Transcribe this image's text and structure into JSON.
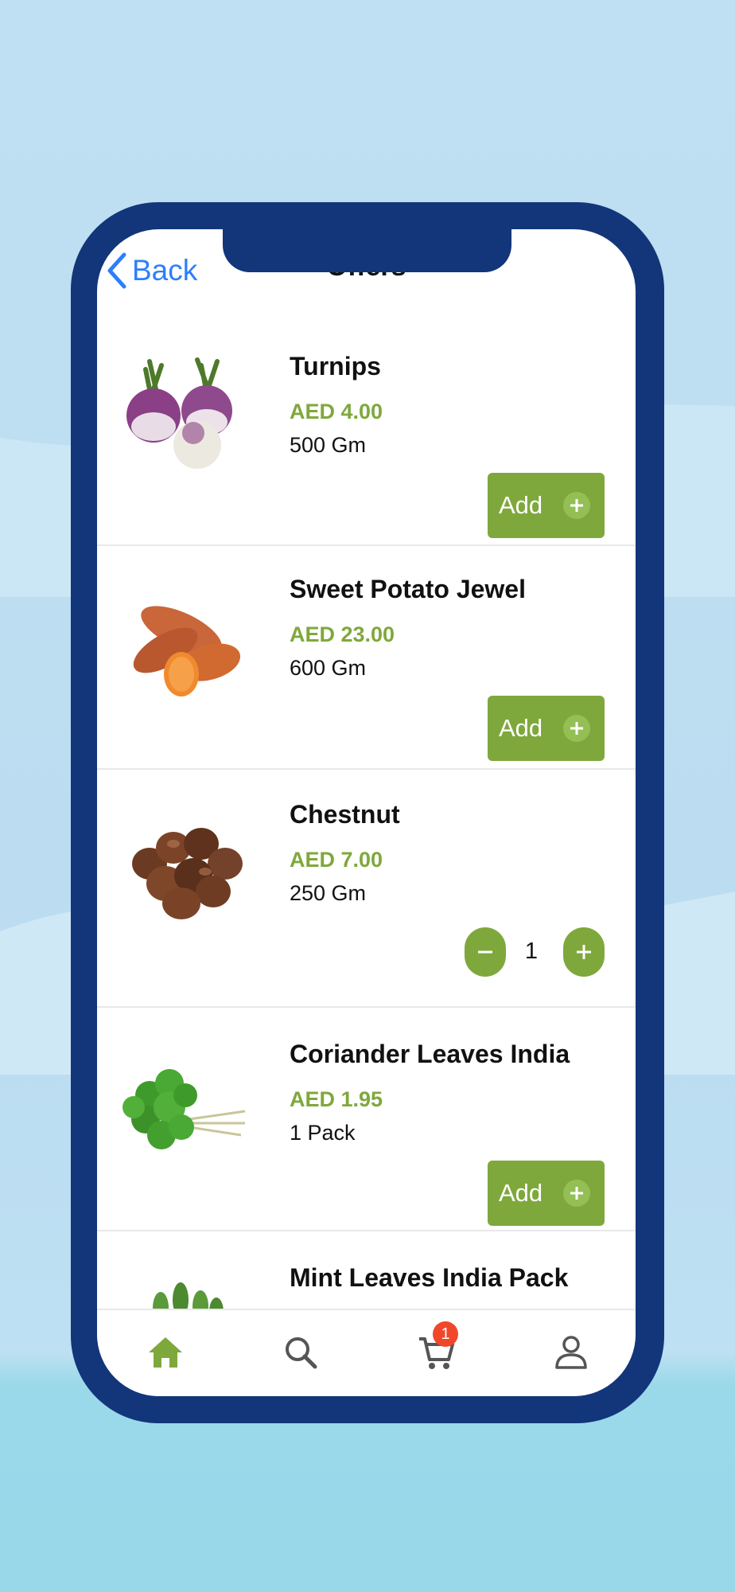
{
  "header": {
    "back_label": "Back",
    "title": "Offers"
  },
  "products": [
    {
      "name": "Turnips",
      "price": "AED 4.00",
      "quantity": "500 Gm",
      "image_icon": "turnip-image",
      "action": "add",
      "add_label": "Add"
    },
    {
      "name": "Sweet Potato Jewel",
      "price": "AED 23.00",
      "quantity": "600 Gm",
      "image_icon": "sweet-potato-image",
      "action": "add",
      "add_label": "Add"
    },
    {
      "name": "Chestnut",
      "price": "AED 7.00",
      "quantity": "250 Gm",
      "image_icon": "chestnut-image",
      "action": "stepper",
      "cart_count": "1"
    },
    {
      "name": "Coriander Leaves India",
      "price": "AED 1.95",
      "quantity": "1 Pack",
      "image_icon": "coriander-image",
      "action": "add",
      "add_label": "Add"
    },
    {
      "name": "Mint Leaves India Pack",
      "image_icon": "mint-image"
    }
  ],
  "tabbar": {
    "tabs": [
      {
        "name": "home",
        "icon": "home-icon",
        "active": true
      },
      {
        "name": "search",
        "icon": "search-icon",
        "active": false
      },
      {
        "name": "cart",
        "icon": "cart-icon",
        "active": false
      },
      {
        "name": "profile",
        "icon": "user-icon",
        "active": false
      }
    ],
    "cart_badge": "1"
  },
  "colors": {
    "accent": "#7fa83c",
    "frame": "#13357a",
    "link": "#2d7ff9",
    "badge": "#f0472b"
  }
}
